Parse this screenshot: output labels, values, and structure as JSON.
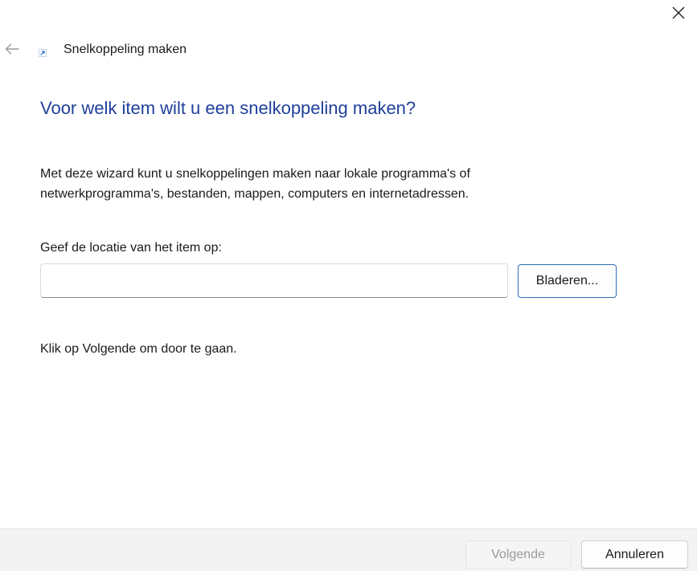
{
  "window": {
    "title": "Snelkoppeling maken",
    "icons": {
      "close": "close-icon",
      "back": "arrow-left-icon",
      "title": "shortcut-icon"
    }
  },
  "main": {
    "heading": "Voor welk item wilt u een snelkoppeling maken?",
    "description": "Met deze wizard kunt u snelkoppelingen maken naar lokale programma's of netwerkprogramma's, bestanden, mappen, computers en internetadressen.",
    "location_label": "Geef de locatie van het item op:",
    "location_value": "",
    "browse_label": "Bladeren...",
    "continue_text": "Klik op Volgende om door te gaan."
  },
  "footer": {
    "next_label": "Volgende",
    "next_disabled": true,
    "cancel_label": "Annuleren"
  },
  "colors": {
    "heading": "#1f3f9a",
    "accent_border": "#2f6db5",
    "footer_bg": "#f3f3f3",
    "disabled_text": "#9a9a9a"
  }
}
